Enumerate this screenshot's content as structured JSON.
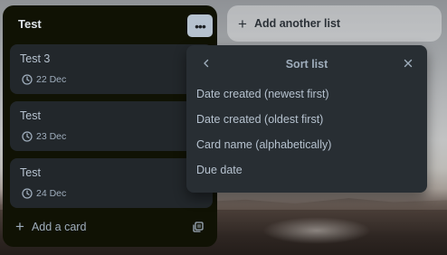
{
  "list": {
    "title": "Test",
    "menu_icon": "ellipsis-icon",
    "cards": [
      {
        "title": "Test 3",
        "date": "22 Dec"
      },
      {
        "title": "Test",
        "date": "23 Dec"
      },
      {
        "title": "Test",
        "date": "24 Dec"
      }
    ],
    "add_card_label": "Add a card"
  },
  "add_list_label": "Add another list",
  "sort_popover": {
    "title": "Sort list",
    "options": [
      "Date created (newest first)",
      "Date created (oldest first)",
      "Card name (alphabetically)",
      "Due date"
    ]
  },
  "colors": {
    "list_bg": "#101204",
    "card_bg": "#22272b",
    "popover_bg": "#282e33",
    "text": "#b6c2cf"
  }
}
